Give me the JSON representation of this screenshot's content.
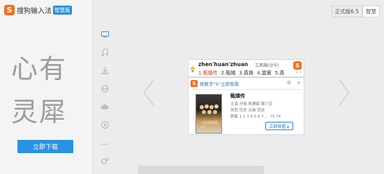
{
  "app": {
    "logo_mark": "S",
    "logo_text": "搜狗输入法",
    "logo_badge": "智慧版"
  },
  "hero": {
    "line1": "心有",
    "line2": "灵犀",
    "download_label": "立即下载"
  },
  "version_tabs": [
    {
      "label": "正式版6.5",
      "active": false
    },
    {
      "label": "智慧",
      "active": true
    }
  ],
  "sidebar_icons": [
    "monitor-icon",
    "music-icon",
    "download-icon",
    "ie-icon",
    "cloud-icon",
    "game-icon",
    "dash-icon",
    "settings-icon"
  ],
  "ime": {
    "pinyin": "zhen'huan'zhuan",
    "tool_label": "工具箱(分号)",
    "candidates": [
      "1.甄嬛传",
      "2.甄嬛",
      "3.真换",
      "4.震寰",
      "5.真"
    ],
    "nav": "‹ ›"
  },
  "card": {
    "title": "按数字“6”立即观看",
    "ctrl_settings": "⚙",
    "ctrl_close": "×",
    "show_title": "甄嬛传",
    "meta_cast": "主演  孙俪 陈建斌 蔡少芬",
    "meta_genre": "类型  历史 古装 宫廷",
    "meta_eps": "剧集  1 2 3 4 5 6 7 ...  75 76",
    "poster_caption": "《后宫甄嬛传》",
    "watch_label": "立即观看 ▸"
  },
  "colors": {
    "brand_orange": "#f3701f",
    "accent_blue": "#2993e2",
    "candidate_red": "#e8372c"
  }
}
